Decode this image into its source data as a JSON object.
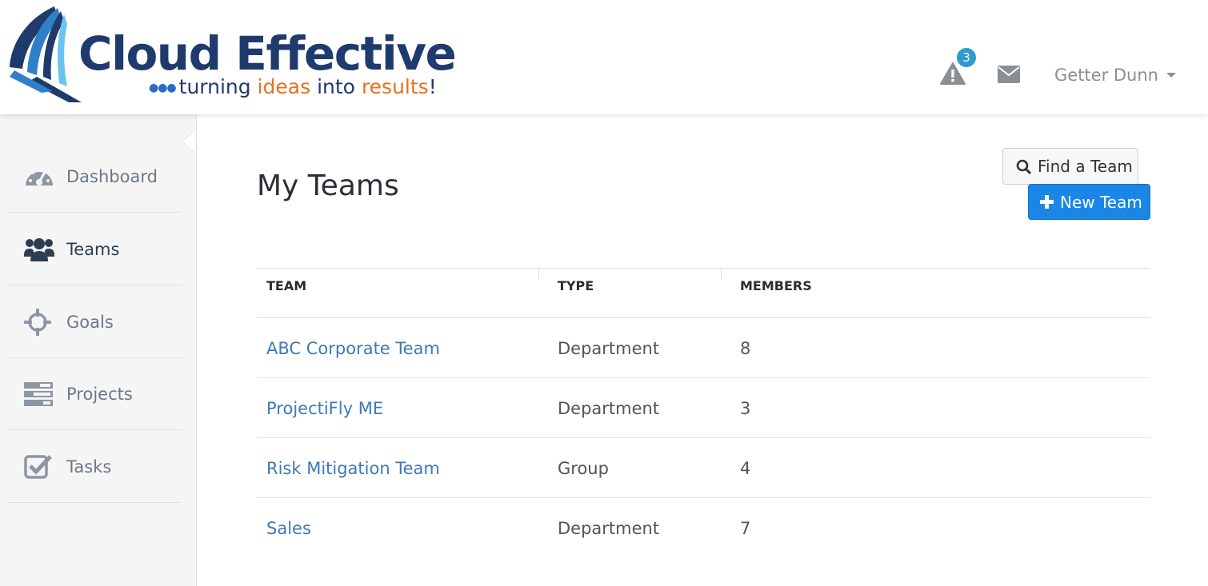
{
  "header": {
    "logo": {
      "name": "Cloud Effective",
      "tagline_dots": "●●●",
      "tagline_part1": "turning ",
      "tagline_part2": "ideas",
      "tagline_part3": " into ",
      "tagline_part4": "results",
      "tagline_part5": "!"
    },
    "notifications": {
      "icon": "warning-icon",
      "count": "3"
    },
    "messages": {
      "icon": "envelope-icon"
    },
    "user": {
      "name": "Getter Dunn"
    }
  },
  "sidebar": {
    "items": [
      {
        "label": "Dashboard",
        "icon": "dashboard-gauge-icon"
      },
      {
        "label": "Teams",
        "icon": "users-icon",
        "active": true
      },
      {
        "label": "Goals",
        "icon": "crosshairs-icon"
      },
      {
        "label": "Projects",
        "icon": "tasks-list-icon"
      },
      {
        "label": "Tasks",
        "icon": "check-square-icon"
      }
    ]
  },
  "main": {
    "title": "My Teams",
    "find_button": "Find a Team",
    "new_button": "New Team",
    "table": {
      "columns": [
        "TEAM",
        "TYPE",
        "MEMBERS"
      ],
      "rows": [
        {
          "team": "ABC Corporate Team",
          "type": "Department",
          "members": "8"
        },
        {
          "team": "ProjectiFly ME",
          "type": "Department",
          "members": "3"
        },
        {
          "team": "Risk Mitigation Team",
          "type": "Group",
          "members": "4"
        },
        {
          "team": "Sales",
          "type": "Department",
          "members": "7"
        }
      ]
    }
  },
  "colors": {
    "brand_navy": "#1f3a6d",
    "brand_orange": "#e8711c",
    "link_blue": "#3d7ab5",
    "primary_button": "#1a86e6",
    "badge_blue": "#2e9ad0"
  }
}
